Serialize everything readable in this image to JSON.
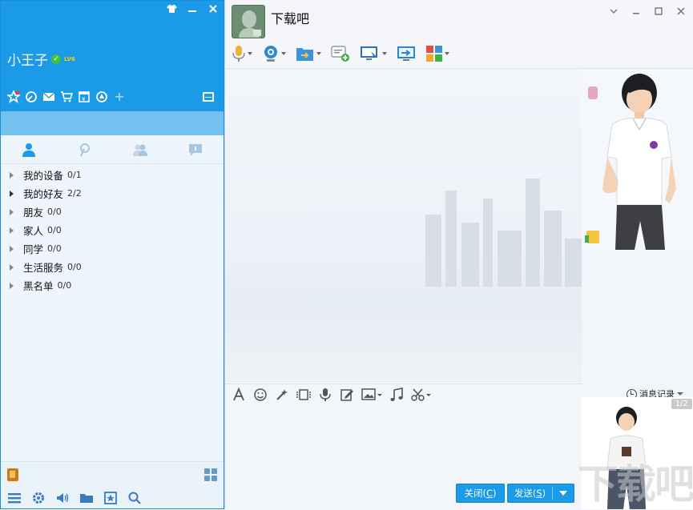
{
  "main": {
    "nickname": "小王子",
    "level": "LV6",
    "groups": [
      {
        "name": "我的设备",
        "count": "0/1"
      },
      {
        "name": "我的好友",
        "count": "2/2"
      },
      {
        "name": "朋友",
        "count": "0/0"
      },
      {
        "name": "家人",
        "count": "0/0"
      },
      {
        "name": "同学",
        "count": "0/0"
      },
      {
        "name": "生活服务",
        "count": "0/0"
      },
      {
        "name": "黑名单",
        "count": "0/0"
      }
    ]
  },
  "chat": {
    "contact_name": "下载吧",
    "history_label": "消息记录",
    "close_label": "关闭(",
    "close_key": "C",
    "close_end": ")",
    "send_label": "发送(",
    "send_key": "S",
    "send_end": ")",
    "page_indicator": "1/2"
  },
  "colors": {
    "header_blue": "#1b9ae8",
    "search_blue": "#74c0ef",
    "accent_icon": "#3a7bbf"
  }
}
